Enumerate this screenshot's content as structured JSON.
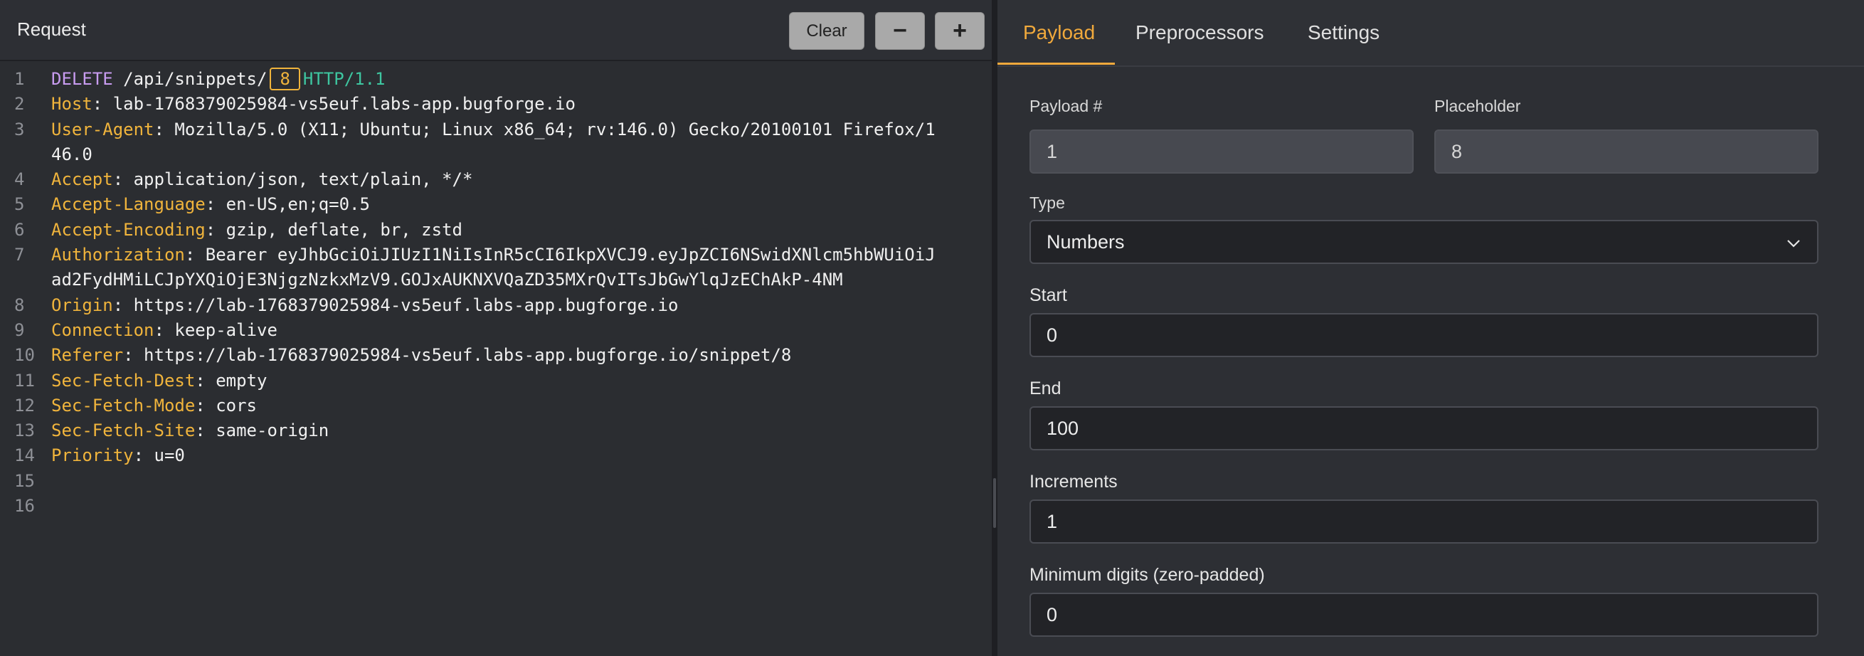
{
  "request": {
    "title": "Request",
    "clear_label": "Clear",
    "minus_label": "−",
    "plus_label": "+",
    "lines": [
      {
        "n": "1",
        "method": "DELETE",
        "path": " /api/snippets/",
        "marker": "8",
        "proto": "HTTP/1.1"
      },
      {
        "n": "2",
        "key": "Host",
        "value": ": lab-1768379025984-vs5euf.labs-app.bugforge.io"
      },
      {
        "n": "3",
        "key": "User-Agent",
        "value": ": Mozilla/5.0 (X11; Ubuntu; Linux x86_64; rv:146.0) Gecko/20100101 Firefox/1"
      },
      {
        "n": "",
        "value": "46.0"
      },
      {
        "n": "4",
        "key": "Accept",
        "value": ": application/json, text/plain, */*"
      },
      {
        "n": "5",
        "key": "Accept-Language",
        "value": ": en-US,en;q=0.5"
      },
      {
        "n": "6",
        "key": "Accept-Encoding",
        "value": ": gzip, deflate, br, zstd"
      },
      {
        "n": "7",
        "key": "Authorization",
        "value": ": Bearer eyJhbGciOiJIUzI1NiIsInR5cCI6IkpXVCJ9.eyJpZCI6NSwidXNlcm5hbWUiOiJ"
      },
      {
        "n": "",
        "value": "ad2FydHMiLCJpYXQiOjE3NjgzNzkxMzV9.GOJxAUKNXVQaZD35MXrQvITsJbGwYlqJzEChAkP-4NM"
      },
      {
        "n": "8",
        "key": "Origin",
        "value": ": https://lab-1768379025984-vs5euf.labs-app.bugforge.io"
      },
      {
        "n": "9",
        "key": "Connection",
        "value": ": keep-alive"
      },
      {
        "n": "10",
        "key": "Referer",
        "value": ": https://lab-1768379025984-vs5euf.labs-app.bugforge.io/snippet/8"
      },
      {
        "n": "11",
        "key": "Sec-Fetch-Dest",
        "value": ": empty"
      },
      {
        "n": "12",
        "key": "Sec-Fetch-Mode",
        "value": ": cors"
      },
      {
        "n": "13",
        "key": "Sec-Fetch-Site",
        "value": ": same-origin"
      },
      {
        "n": "14",
        "key": "Priority",
        "value": ": u=0"
      },
      {
        "n": "15",
        "value": ""
      },
      {
        "n": "16",
        "value": ""
      }
    ]
  },
  "config": {
    "tabs": [
      "Payload",
      "Preprocessors",
      "Settings"
    ],
    "active_tab": "Payload",
    "payload_num_label": "Payload #",
    "payload_num_value": "1",
    "placeholder_label": "Placeholder",
    "placeholder_value": "8",
    "type_label": "Type",
    "type_value": "Numbers",
    "start_label": "Start",
    "start_value": "0",
    "end_label": "End",
    "end_value": "100",
    "increments_label": "Increments",
    "increments_value": "1",
    "min_digits_label": "Minimum digits (zero-padded)",
    "min_digits_value": "0"
  },
  "colors": {
    "accent": "#f0a93c",
    "header_key": "#f0b43c",
    "method": "#c89cf0",
    "protocol": "#3ec6a0"
  },
  "icons": {
    "type_select": "chevron-down-icon"
  }
}
